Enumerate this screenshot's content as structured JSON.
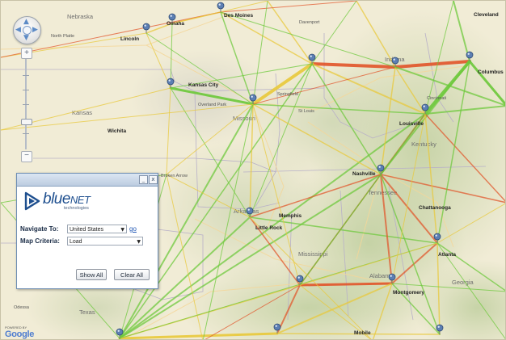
{
  "map": {
    "states": [
      {
        "name": "Nebraska"
      },
      {
        "name": "Kansas"
      },
      {
        "name": "Missouri"
      },
      {
        "name": "Indiana"
      },
      {
        "name": "Kentucky"
      },
      {
        "name": "Tennessee"
      },
      {
        "name": "Arkansas"
      },
      {
        "name": "Mississippi"
      },
      {
        "name": "Alabama"
      },
      {
        "name": "Georgia"
      },
      {
        "name": "Texas"
      }
    ],
    "cities": [
      {
        "name": "Omaha"
      },
      {
        "name": "Lincoln"
      },
      {
        "name": "North Platte"
      },
      {
        "name": "Des Moines"
      },
      {
        "name": "Davenport"
      },
      {
        "name": "Cleveland"
      },
      {
        "name": "Columbus"
      },
      {
        "name": "Cincinnati"
      },
      {
        "name": "Louisville"
      },
      {
        "name": "St Louis"
      },
      {
        "name": "Kansas City"
      },
      {
        "name": "Overland Park"
      },
      {
        "name": "Springfield"
      },
      {
        "name": "Wichita"
      },
      {
        "name": "Broken Arrow"
      },
      {
        "name": "Nashville"
      },
      {
        "name": "Chattanooga"
      },
      {
        "name": "Memphis"
      },
      {
        "name": "Little Rock"
      },
      {
        "name": "Atlanta"
      },
      {
        "name": "Montgomery"
      },
      {
        "name": "Mobile"
      },
      {
        "name": "Odessa"
      }
    ],
    "colors": {
      "low": "#6cc93a",
      "mid": "#e9c93a",
      "high": "#e2552a",
      "pin": "#5c7fb3"
    }
  },
  "controls": {
    "pan_icons": [
      "pan-up-icon",
      "pan-down-icon",
      "pan-left-icon",
      "pan-right-icon"
    ],
    "zoom_in_label": "+",
    "zoom_out_label": "−"
  },
  "panel": {
    "logo_brand_main": "blue",
    "logo_brand_net": "NET",
    "logo_sub": "technologies",
    "navigate_label": "Navigate To:",
    "navigate_value": "United States",
    "go_label": "go",
    "criteria_label": "Map Criteria:",
    "criteria_value": "Load",
    "show_all_label": "Show All",
    "clear_all_label": "Clear All",
    "minimize_label": "_",
    "close_label": "x"
  },
  "attribution": {
    "google": "Google",
    "powered_by": "POWERED BY"
  }
}
